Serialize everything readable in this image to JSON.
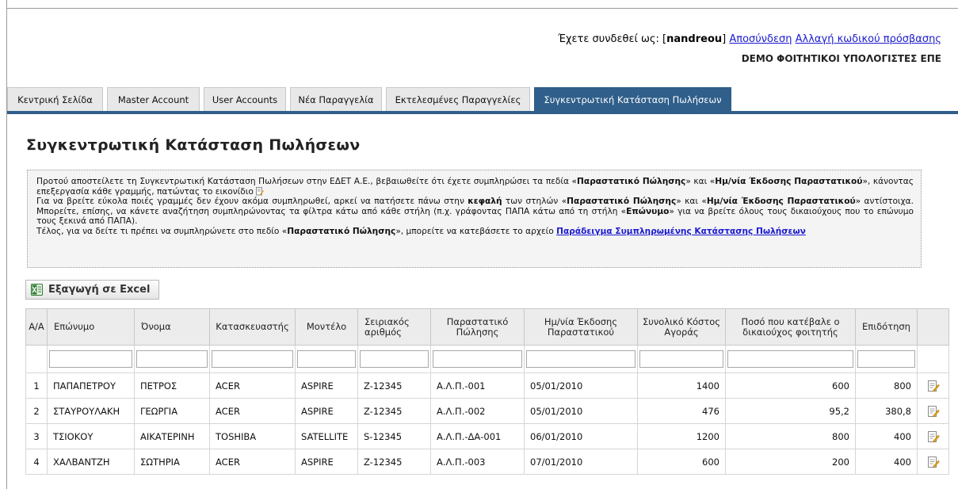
{
  "header": {
    "login_prefix": "Έχετε συνδεθεί ως: [",
    "username": "nandreou",
    "login_suffix": "]",
    "logout_link": "Αποσύνδεση",
    "change_password_link": "Αλλαγή κωδικού πρόσβασης",
    "company": "DEMO ΦΟΙΤΗΤΙΚΟΙ ΥΠΟΛΟΓΙΣΤΕΣ ΕΠΕ"
  },
  "tabs": [
    {
      "label": "Κεντρική Σελίδα"
    },
    {
      "label": "Master Account"
    },
    {
      "label": "User Accounts"
    },
    {
      "label": "Νέα Παραγγελία"
    },
    {
      "label": "Εκτελεσμένες Παραγγελίες"
    },
    {
      "label": "Συγκεντρωτική Κατάσταση Πωλήσεων",
      "active": true
    }
  ],
  "page": {
    "title": "Συγκεντρωτική Κατάσταση Πωλήσεων"
  },
  "notice": {
    "p1_a": "Προτού αποστείλετε τη Συγκεντρωτική Κατάσταση Πωλήσεων στην ΕΔΕΤ Α.Ε., βεβαιωθείτε ότι έχετε συμπληρώσει τα πεδία «",
    "p1_b1": "Παραστατικό Πώλησης",
    "p1_c": "» και «",
    "p1_b2": "Ημ/νία Έκδοσης Παραστατικού",
    "p1_d": "», κάνοντας επεξεργασία κάθε γραμμής, πατώντας το εικονίδιο",
    "p2_a": "Για να βρείτε εύκολα ποιές γραμμές δεν έχουν ακόμα συμπληρωθεί, αρκεί να πατήσετε πάνω στην ",
    "p2_b1": "κεφαλή",
    "p2_c": " των στηλών «",
    "p2_b2": "Παραστατικό Πώλησης",
    "p2_d": "» και «",
    "p2_b3": "Ημ/νία Έκδοσης Παραστατικού",
    "p2_e": "» αντίστοιχα. Μπορείτε, επίσης, να κάνετε αναζήτηση συμπληρώνοντας τα φίλτρα κάτω από κάθε στήλη (π.χ. γράφοντας ΠΑΠΑ κάτω από τη στήλη «",
    "p2_b4": "Επώνυμο",
    "p2_f": "» για να βρείτε όλους τους δικαιούχους που το επώνυμο τους ξεκινά από ΠΑΠΑ).",
    "p3_a": "Τέλος, για να δείτε τι πρέπει να συμπληρώνετε στο πεδίο «",
    "p3_b1": "Παραστατικό Πώλησης",
    "p3_c": "», μπορείτε να κατεβάσετε το αρχείο ",
    "p3_link": "Παράδειγμα Συμπληρωμένης Κατάστασης Πωλήσεων"
  },
  "export_button": "Εξαγωγή σε Excel",
  "table": {
    "headers": [
      "Α/Α",
      "Επώνυμο",
      "Όνομα",
      "Κατασκευαστής",
      "Μοντέλο",
      "Σειριακός αριθμός",
      "Παραστατικό Πώλησης",
      "Ημ/νία Έκδοσης Παραστατικού",
      "Συνολικό Κόστος Αγοράς",
      "Ποσό που κατέβαλε ο δικαιούχος φοιτητής",
      "Επιδότηση"
    ],
    "rows": [
      [
        "1",
        "ΠΑΠΑΠΕΤΡΟΥ",
        "ΠΕΤΡΟΣ",
        "ACER",
        "ASPIRE",
        "Z-12345",
        "Α.Λ.Π.-001",
        "05/01/2010",
        "1400",
        "600",
        "800"
      ],
      [
        "2",
        "ΣΤΑΥΡΟΥΛΑΚΗ",
        "ΓΕΩΡΓΙΑ",
        "ACER",
        "ASPIRE",
        "Z-12345",
        "Α.Λ.Π.-002",
        "05/01/2010",
        "476",
        "95,2",
        "380,8"
      ],
      [
        "3",
        "ΤΣΙΟΚΟΥ",
        "ΑΙΚΑΤΕΡΙΝΗ",
        "TOSHIBA",
        "SATELLITE",
        "S-12345",
        "Α.Λ.Π.-ΔΑ-001",
        "06/01/2010",
        "1200",
        "800",
        "400"
      ],
      [
        "4",
        "ΧΑΛΒΑΝΤΖΗ",
        "ΣΩΤΗΡΙΑ",
        "ACER",
        "ASPIRE",
        "Z-12345",
        "Α.Λ.Π.-003",
        "07/01/2010",
        "600",
        "200",
        "400"
      ]
    ],
    "row_action_icon": "edit-document-icon"
  },
  "colors": {
    "tab_active": "#2f5f8a",
    "link": "#1a1ad0",
    "notice_bg": "#f4f4f4",
    "header_bg": "#ececec"
  }
}
